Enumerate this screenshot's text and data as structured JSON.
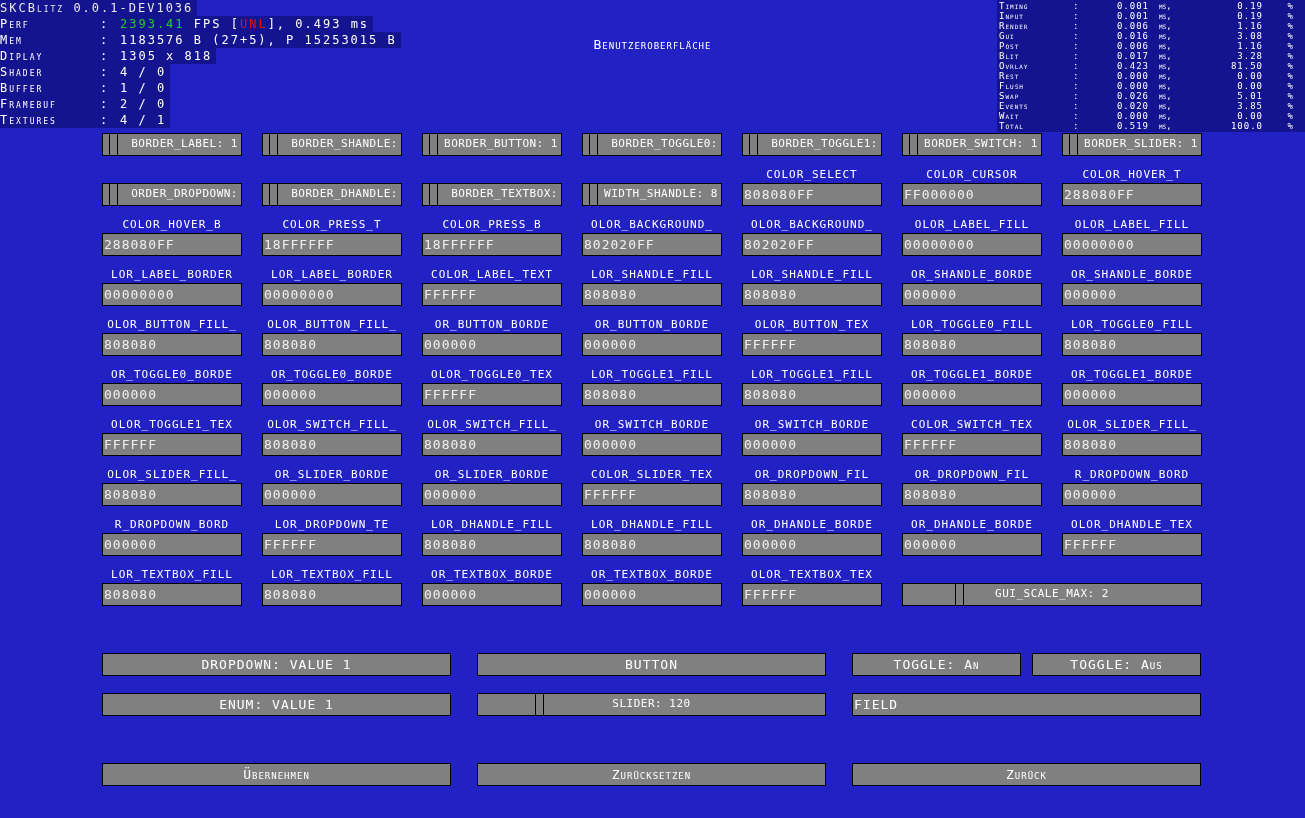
{
  "title": "Benutzeroberfläche",
  "debug": {
    "title": "SKCBlitz 0.0.1-DEV1036",
    "rows": [
      {
        "label": "Perf",
        "separator": ":",
        "segments": [
          {
            "text": "2393.41",
            "color": "#20d020"
          },
          {
            "text": " FPS ["
          },
          {
            "text": "UNL",
            "color": "#e01010"
          },
          {
            "text": "], 0.493 ms"
          }
        ]
      },
      {
        "label": "Mem",
        "separator": ":",
        "segments": [
          {
            "text": "1183576 B (27+5), P 15253015 B"
          }
        ]
      },
      {
        "label": "Diplay",
        "separator": ":",
        "segments": [
          {
            "text": "1305 x 818"
          }
        ]
      },
      {
        "label": "Shader",
        "separator": ":",
        "segments": [
          {
            "text": "4 / 0"
          }
        ]
      },
      {
        "label": "Buffer",
        "separator": ":",
        "segments": [
          {
            "text": "1 / 0"
          }
        ]
      },
      {
        "label": "Framebuf",
        "separator": ":",
        "segments": [
          {
            "text": "2 / 0"
          }
        ]
      },
      {
        "label": "Textures",
        "separator": ":",
        "segments": [
          {
            "text": "4 / 1"
          }
        ]
      }
    ]
  },
  "timing": [
    {
      "label": "Timing",
      "separator": ":",
      "ms": "0.001",
      "unit": "ms,",
      "percent": "0.19",
      "sign": "%"
    },
    {
      "label": "Input",
      "separator": ":",
      "ms": "0.001",
      "unit": "ms,",
      "percent": "0.19",
      "sign": "%"
    },
    {
      "label": "Render",
      "separator": ":",
      "ms": "0.006",
      "unit": "ms,",
      "percent": "1.16",
      "sign": "%"
    },
    {
      "label": "Gui",
      "separator": ":",
      "ms": "0.016",
      "unit": "ms,",
      "percent": "3.08",
      "sign": "%"
    },
    {
      "label": "Post",
      "separator": ":",
      "ms": "0.006",
      "unit": "ms,",
      "percent": "1.16",
      "sign": "%"
    },
    {
      "label": "Blit",
      "separator": ":",
      "ms": "0.017",
      "unit": "ms,",
      "percent": "3.28",
      "sign": "%"
    },
    {
      "label": "Ovrlay",
      "separator": ":",
      "ms": "0.423",
      "unit": "ms,",
      "percent": "81.50",
      "sign": "%"
    },
    {
      "label": "Rest",
      "separator": ":",
      "ms": "0.000",
      "unit": "ms,",
      "percent": "0.00",
      "sign": "%"
    },
    {
      "label": "Flush",
      "separator": ":",
      "ms": "0.000",
      "unit": "ms,",
      "percent": "0.00",
      "sign": "%"
    },
    {
      "label": "Swap",
      "separator": ":",
      "ms": "0.026",
      "unit": "ms,",
      "percent": "5.01",
      "sign": "%"
    },
    {
      "label": "Events",
      "separator": ":",
      "ms": "0.020",
      "unit": "ms,",
      "percent": "3.85",
      "sign": "%"
    },
    {
      "label": "Wait",
      "separator": ":",
      "ms": "0.000",
      "unit": "ms,",
      "percent": "0.00",
      "sign": "%"
    },
    {
      "label": "Total",
      "separator": ":",
      "ms": "0.519",
      "unit": "ms,",
      "percent": "100.0",
      "sign": "%"
    }
  ],
  "settings": [
    {
      "kind": "slider",
      "text": "BORDER_LABEL: 1",
      "level": 0.05
    },
    {
      "kind": "slider",
      "text": "BORDER_SHANDLE:",
      "level": 0.05
    },
    {
      "kind": "slider",
      "text": "BORDER_BUTTON: 1",
      "level": 0.05
    },
    {
      "kind": "slider",
      "text": "BORDER_TOGGLE0:",
      "level": 0.05
    },
    {
      "kind": "slider",
      "text": "BORDER_TOGGLE1:",
      "level": 0.05
    },
    {
      "kind": "slider",
      "text": "BORDER_SWITCH: 1",
      "level": 0.05
    },
    {
      "kind": "slider",
      "text": "BORDER_SLIDER: 1",
      "level": 0.05
    },
    {
      "kind": "slider",
      "text": "ORDER_DROPDOWN:",
      "level": 0.05
    },
    {
      "kind": "slider",
      "text": "BORDER_DHANDLE:",
      "level": 0.05
    },
    {
      "kind": "slider",
      "text": "BORDER_TEXTBOX:",
      "level": 0.05
    },
    {
      "kind": "slider",
      "text": "WIDTH_SHANDLE: 8",
      "level": 0.05
    },
    {
      "kind": "color",
      "label": "COLOR_SELECT",
      "value": "808080FF"
    },
    {
      "kind": "color",
      "label": "COLOR_CURSOR",
      "value": "FF000000"
    },
    {
      "kind": "color",
      "label": "COLOR_HOVER_T",
      "value": "288080FF"
    },
    {
      "kind": "color",
      "label": "COLOR_HOVER_B",
      "value": "288080FF"
    },
    {
      "kind": "color",
      "label": "COLOR_PRESS_T",
      "value": "18FFFFFF"
    },
    {
      "kind": "color",
      "label": "COLOR_PRESS_B",
      "value": "18FFFFFF"
    },
    {
      "kind": "color",
      "label": "OLOR_BACKGROUND_",
      "value": "802020FF"
    },
    {
      "kind": "color",
      "label": "OLOR_BACKGROUND_",
      "value": "802020FF"
    },
    {
      "kind": "color",
      "label": "OLOR_LABEL_FILL",
      "value": "00000000"
    },
    {
      "kind": "color",
      "label": "OLOR_LABEL_FILL",
      "value": "00000000"
    },
    {
      "kind": "color",
      "label": "LOR_LABEL_BORDER",
      "value": "00000000"
    },
    {
      "kind": "color",
      "label": "LOR_LABEL_BORDER",
      "value": "00000000"
    },
    {
      "kind": "color",
      "label": "COLOR_LABEL_TEXT",
      "value": "FFFFFF"
    },
    {
      "kind": "color",
      "label": "LOR_SHANDLE_FILL",
      "value": "808080"
    },
    {
      "kind": "color",
      "label": "LOR_SHANDLE_FILL",
      "value": "808080"
    },
    {
      "kind": "color",
      "label": "OR_SHANDLE_BORDE",
      "value": "000000"
    },
    {
      "kind": "color",
      "label": "OR_SHANDLE_BORDE",
      "value": "000000"
    },
    {
      "kind": "color",
      "label": "OLOR_BUTTON_FILL_",
      "value": "808080"
    },
    {
      "kind": "color",
      "label": "OLOR_BUTTON_FILL_",
      "value": "808080"
    },
    {
      "kind": "color",
      "label": "OR_BUTTON_BORDE",
      "value": "000000"
    },
    {
      "kind": "color",
      "label": "OR_BUTTON_BORDE",
      "value": "000000"
    },
    {
      "kind": "color",
      "label": "OLOR_BUTTON_TEX",
      "value": "FFFFFF"
    },
    {
      "kind": "color",
      "label": "LOR_TOGGLE0_FILL",
      "value": "808080"
    },
    {
      "kind": "color",
      "label": "LOR_TOGGLE0_FILL",
      "value": "808080"
    },
    {
      "kind": "color",
      "label": "OR_TOGGLE0_BORDE",
      "value": "000000"
    },
    {
      "kind": "color",
      "label": "OR_TOGGLE0_BORDE",
      "value": "000000"
    },
    {
      "kind": "color",
      "label": "OLOR_TOGGLE0_TEX",
      "value": "FFFFFF"
    },
    {
      "kind": "color",
      "label": "LOR_TOGGLE1_FILL",
      "value": "808080"
    },
    {
      "kind": "color",
      "label": "LOR_TOGGLE1_FILL",
      "value": "808080"
    },
    {
      "kind": "color",
      "label": "OR_TOGGLE1_BORDE",
      "value": "000000"
    },
    {
      "kind": "color",
      "label": "OR_TOGGLE1_BORDE",
      "value": "000000"
    },
    {
      "kind": "color",
      "label": "OLOR_TOGGLE1_TEX",
      "value": "FFFFFF"
    },
    {
      "kind": "color",
      "label": "OLOR_SWITCH_FILL_",
      "value": "808080"
    },
    {
      "kind": "color",
      "label": "OLOR_SWITCH_FILL_",
      "value": "808080"
    },
    {
      "kind": "color",
      "label": "OR_SWITCH_BORDE",
      "value": "000000"
    },
    {
      "kind": "color",
      "label": "OR_SWITCH_BORDE",
      "value": "000000"
    },
    {
      "kind": "color",
      "label": "COLOR_SWITCH_TEX",
      "value": "FFFFFF"
    },
    {
      "kind": "color",
      "label": "OLOR_SLIDER_FILL_",
      "value": "808080"
    },
    {
      "kind": "color",
      "label": "OLOR_SLIDER_FILL_",
      "value": "808080"
    },
    {
      "kind": "color",
      "label": "OR_SLIDER_BORDE",
      "value": "000000"
    },
    {
      "kind": "color",
      "label": "OR_SLIDER_BORDE",
      "value": "000000"
    },
    {
      "kind": "color",
      "label": "COLOR_SLIDER_TEX",
      "value": "FFFFFF"
    },
    {
      "kind": "color",
      "label": "OR_DROPDOWN_FIL",
      "value": "808080"
    },
    {
      "kind": "color",
      "label": "OR_DROPDOWN_FIL",
      "value": "808080"
    },
    {
      "kind": "color",
      "label": "R_DROPDOWN_BORD",
      "value": "000000"
    },
    {
      "kind": "color",
      "label": "R_DROPDOWN_BORD",
      "value": "000000"
    },
    {
      "kind": "color",
      "label": "LOR_DROPDOWN_TE",
      "value": "FFFFFF"
    },
    {
      "kind": "color",
      "label": "LOR_DHANDLE_FILL",
      "value": "808080"
    },
    {
      "kind": "color",
      "label": "LOR_DHANDLE_FILL",
      "value": "808080"
    },
    {
      "kind": "color",
      "label": "OR_DHANDLE_BORDE",
      "value": "000000"
    },
    {
      "kind": "color",
      "label": "OR_DHANDLE_BORDE",
      "value": "000000"
    },
    {
      "kind": "color",
      "label": "OLOR_DHANDLE_TEX",
      "value": "FFFFFF"
    },
    {
      "kind": "color",
      "label": "LOR_TEXTBOX_FILL",
      "value": "808080"
    },
    {
      "kind": "color",
      "label": "LOR_TEXTBOX_FILL",
      "value": "808080"
    },
    {
      "kind": "color",
      "label": "OR_TEXTBOX_BORDE",
      "value": "000000"
    },
    {
      "kind": "color",
      "label": "OR_TEXTBOX_BORDE",
      "value": "000000"
    },
    {
      "kind": "color",
      "label": "OLOR_TEXTBOX_TEX",
      "value": "FFFFFF"
    },
    {
      "kind": "wide_slider",
      "text": "GUI_SCALE_MAX: 2",
      "level": 0.18
    }
  ],
  "controls": [
    {
      "kind": "dropdown",
      "text": "DROPDOWN: VALUE 1"
    },
    {
      "kind": "button",
      "text": "BUTTON"
    },
    {
      "kind": "toggles",
      "items": [
        {
          "text": "TOGGLE: An"
        },
        {
          "text": "TOGGLE: Aus"
        }
      ]
    },
    {
      "kind": "dropdown",
      "text": "ENUM: VALUE 1"
    },
    {
      "kind": "slider",
      "text": "SLIDER: 120",
      "level": 0.17
    },
    {
      "kind": "textbox",
      "value": "FIELD"
    }
  ],
  "actions": [
    "Übernehmen",
    "Zurücksetzen",
    "Zurück"
  ]
}
